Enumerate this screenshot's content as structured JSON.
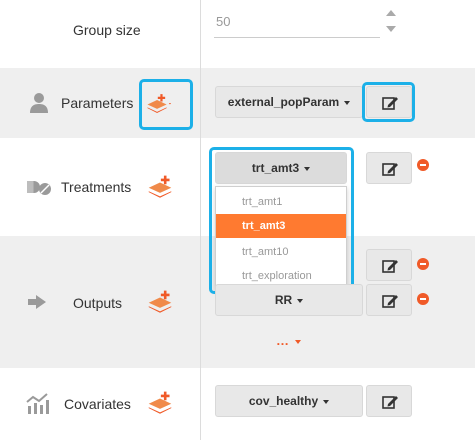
{
  "group_size": {
    "label": "Group size",
    "value": "50"
  },
  "parameters": {
    "label": "Parameters",
    "selected": "external_popParam"
  },
  "treatments": {
    "label": "Treatments",
    "selected": "trt_amt3",
    "options": [
      "trt_amt1",
      "trt_amt3",
      "trt_amt10",
      "trt_exploration"
    ],
    "highlighted_option": "trt_amt3"
  },
  "outputs": {
    "label": "Outputs",
    "items": [
      "",
      "RR"
    ],
    "more_label": "…"
  },
  "covariates": {
    "label": "Covariates",
    "selected": "cov_healthy"
  },
  "icons": {
    "person": "person-icon",
    "pills": "pills-icon",
    "output": "output-arrow-icon",
    "chart": "chart-icon",
    "add_layer": "add-layer-icon",
    "edit": "edit-icon",
    "remove": "remove-icon"
  },
  "colors": {
    "accent": "#f05a28",
    "highlight": "#1cb0e8",
    "selected_option": "#ff7a30"
  }
}
